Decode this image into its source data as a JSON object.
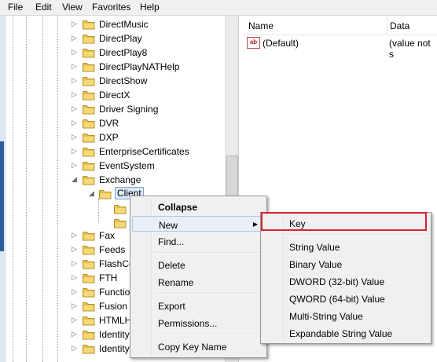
{
  "menubar": [
    "File",
    "Edit",
    "View",
    "Favorites",
    "Help"
  ],
  "tree": {
    "items": [
      {
        "label": "DirectMusic"
      },
      {
        "label": "DirectPlay"
      },
      {
        "label": "DirectPlay8"
      },
      {
        "label": "DirectPlayNATHelp"
      },
      {
        "label": "DirectShow"
      },
      {
        "label": "DirectX"
      },
      {
        "label": "Driver Signing"
      },
      {
        "label": "DVR"
      },
      {
        "label": "DXP"
      },
      {
        "label": "EnterpriseCertificates"
      },
      {
        "label": "EventSystem"
      },
      {
        "label": "Exchange"
      },
      {
        "label": "Client"
      },
      {
        "label": "Fax"
      },
      {
        "label": "Feeds"
      },
      {
        "label": "FlashCo"
      },
      {
        "label": "FTH"
      },
      {
        "label": "Functio"
      },
      {
        "label": "Fusion"
      },
      {
        "label": "HTMLH"
      },
      {
        "label": "Identity"
      },
      {
        "label": "Identity"
      }
    ]
  },
  "list": {
    "columns": [
      "Name",
      "Data"
    ],
    "rows": [
      {
        "name": "(Default)",
        "data": "(value not s"
      }
    ],
    "value_icon": "string-value-icon"
  },
  "context_menu": {
    "collapse": "Collapse",
    "new": "New",
    "find": "Find...",
    "delete": "Delete",
    "rename": "Rename",
    "export": "Export",
    "permissions": "Permissions...",
    "copy_key_name": "Copy Key Name"
  },
  "new_submenu": {
    "key": "Key",
    "string_value": "String Value",
    "binary_value": "Binary Value",
    "dword_value": "DWORD (32-bit) Value",
    "qword_value": "QWORD (64-bit) Value",
    "multi_string_value": "Multi-String Value",
    "expandable_string_value": "Expandable String Value"
  },
  "colors": {
    "highlight_border": "#d9232d",
    "folder": "#e8c14d",
    "selection": "#dde9f8"
  }
}
